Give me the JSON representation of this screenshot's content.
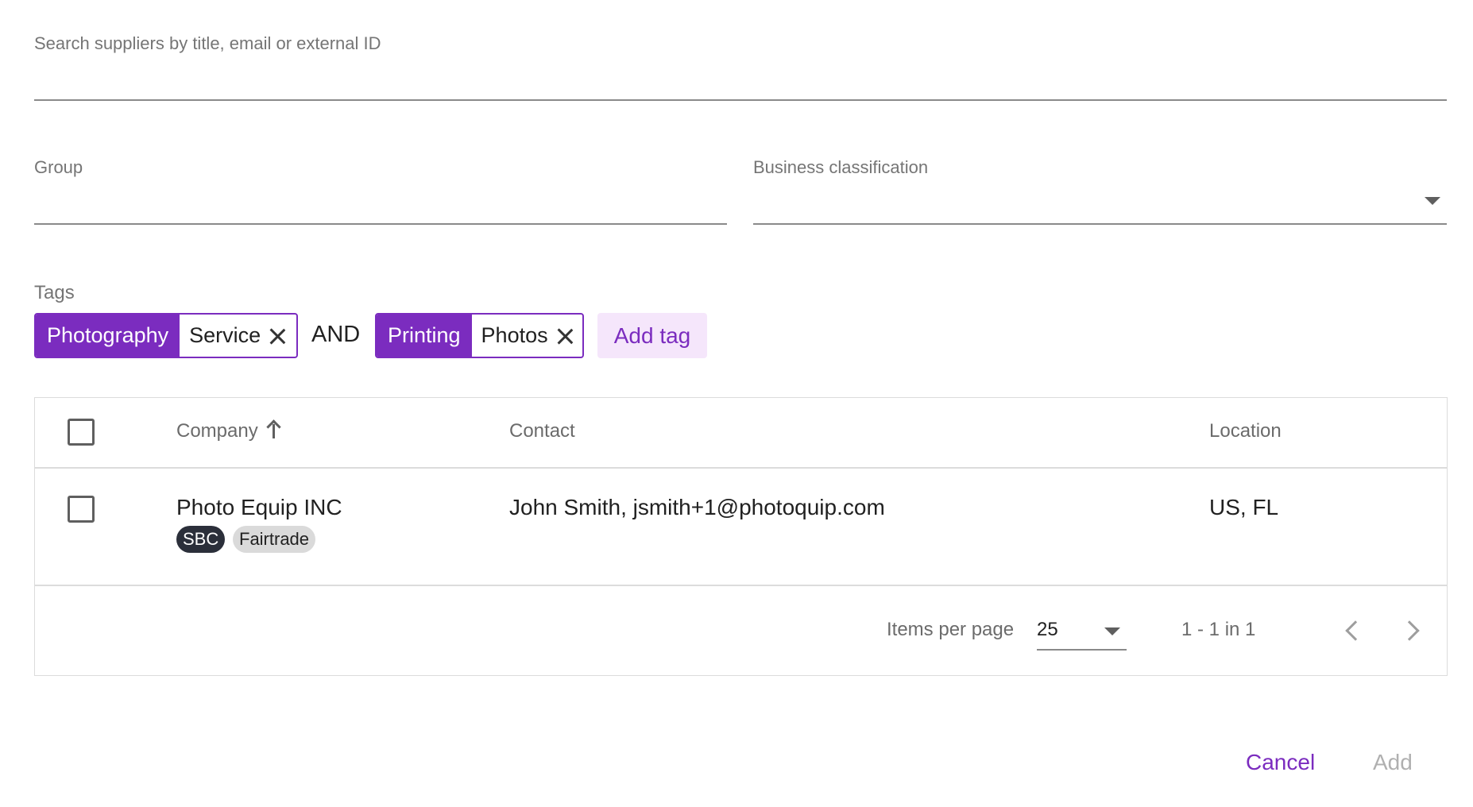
{
  "search": {
    "placeholder": "Search suppliers by title, email or external ID",
    "value": ""
  },
  "group": {
    "label": "Group",
    "value": ""
  },
  "business_classification": {
    "label": "Business classification",
    "value": ""
  },
  "tags": {
    "label": "Tags",
    "filters": [
      {
        "category": "Photography",
        "value": "Service"
      },
      {
        "category": "Printing",
        "value": "Photos"
      }
    ],
    "operator": "AND",
    "add_label": "Add tag"
  },
  "table": {
    "columns": {
      "company": "Company",
      "contact": "Contact",
      "location": "Location"
    },
    "sort": {
      "column": "company",
      "direction": "asc"
    },
    "rows": [
      {
        "company": "Photo Equip INC",
        "badges": [
          "SBC",
          "Fairtrade"
        ],
        "contact": "John Smith, jsmith+1@photoquip.com",
        "location": "US, FL"
      }
    ]
  },
  "pagination": {
    "items_per_page_label": "Items per page",
    "items_per_page": "25",
    "range": "1 - 1 in 1"
  },
  "footer": {
    "cancel_label": "Cancel",
    "add_label": "Add"
  },
  "colors": {
    "accent": "#7b2cbf",
    "accent_light": "#f5e6fb",
    "badge_dark": "#2b2f3a",
    "badge_light": "#dadada"
  }
}
